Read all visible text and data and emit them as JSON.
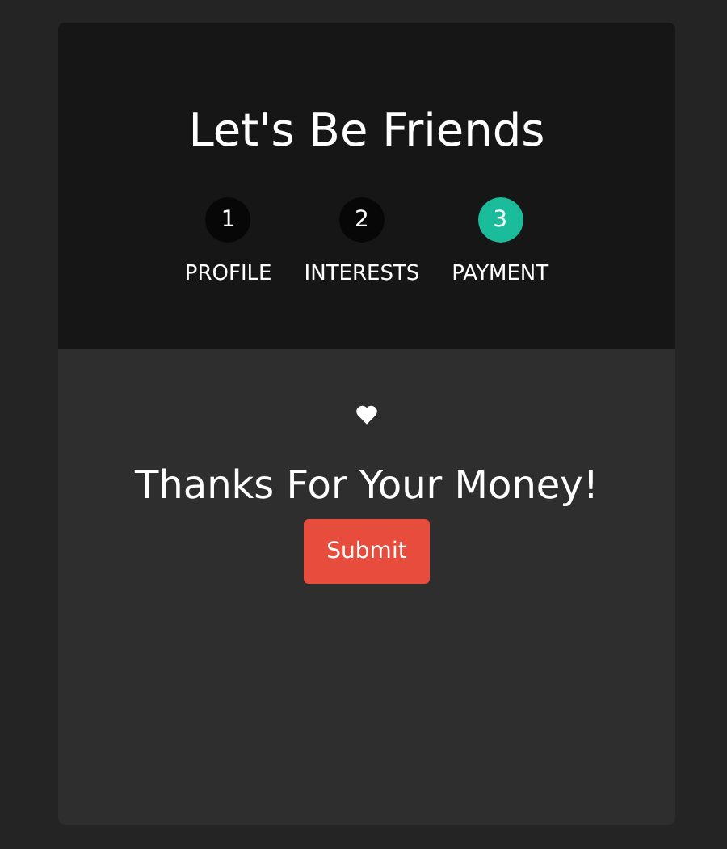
{
  "title": "Let's Be Friends",
  "steps": [
    {
      "number": "1",
      "label": "PROFILE",
      "selected": false
    },
    {
      "number": "2",
      "label": "INTERESTS",
      "selected": false
    },
    {
      "number": "3",
      "label": "PAYMENT",
      "selected": true
    }
  ],
  "message": "Thanks For Your Money!",
  "button": "Submit"
}
